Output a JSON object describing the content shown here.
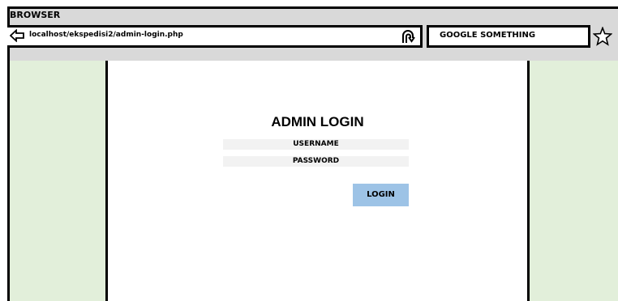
{
  "window": {
    "title": "BROWSER"
  },
  "address_bar": {
    "url": "localhost/ekspedisi2/admin-login.php"
  },
  "search_box": {
    "value": "GOOGLE SOMETHING"
  },
  "icons": {
    "back": "arrow-left-icon",
    "refresh": "refresh-icon",
    "bookmark": "star-icon"
  },
  "page": {
    "title": "ADMIN LOGIN",
    "username_placeholder": "USERNAME",
    "password_placeholder": "PASSWORD",
    "login_label": "LOGIN"
  },
  "colors": {
    "side_panels": "#e2efda",
    "login_button": "#9dc3e6",
    "input_background": "#f2f2f2",
    "chrome_background": "#d9d9d9"
  }
}
